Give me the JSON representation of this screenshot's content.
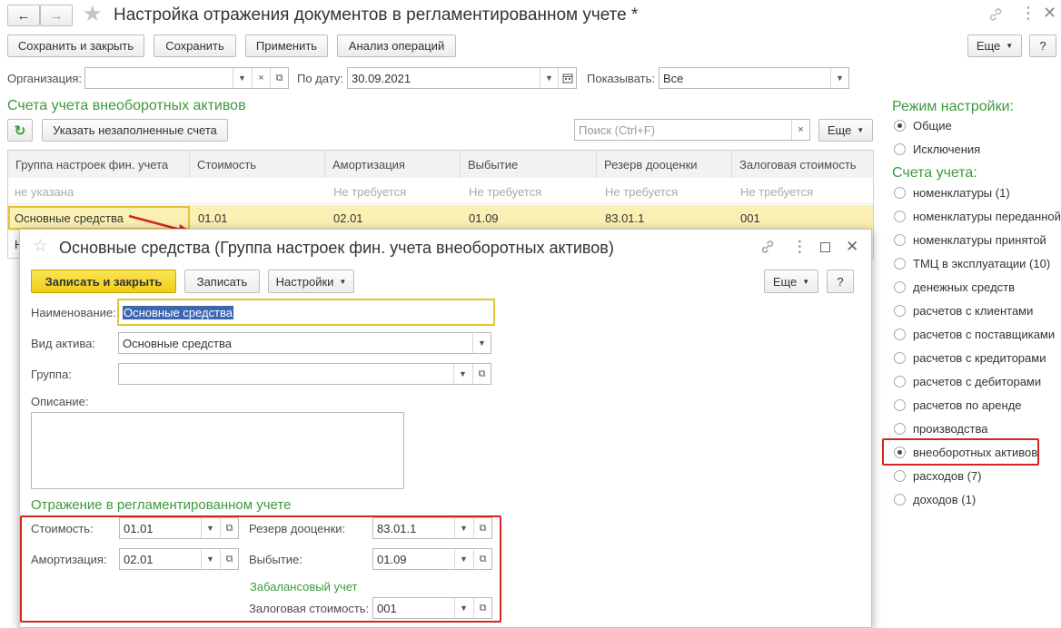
{
  "window": {
    "title": "Настройка отражения документов в регламентированном учете *",
    "nav_back": "←",
    "nav_forward": "→"
  },
  "toolbar": {
    "save_close": "Сохранить и закрыть",
    "save": "Сохранить",
    "apply": "Применить",
    "analysis": "Анализ операций",
    "more": "Еще",
    "help": "?"
  },
  "filters": {
    "org_label": "Организация:",
    "org_value": "",
    "date_label": "По дату:",
    "date_value": "30.09.2021",
    "show_label": "Показывать:",
    "show_value": "Все"
  },
  "accounts_section": {
    "title": "Счета учета внеоборотных активов",
    "fill_empty_button": "Указать незаполненные счета",
    "search_placeholder": "Поиск (Ctrl+F)",
    "more": "Еще",
    "columns": [
      "Группа настроек фин. учета",
      "Стоимость",
      "Амортизация",
      "Выбытие",
      "Резерв дооценки",
      "Залоговая стоимость"
    ],
    "rows": [
      [
        "не указана",
        "",
        "Не требуется",
        "Не требуется",
        "Не требуется",
        "Не требуется"
      ],
      [
        "Основные средства",
        "01.01",
        "02.01",
        "01.09",
        "83.01.1",
        "001"
      ]
    ],
    "partial_row": "Н"
  },
  "right_panel": {
    "mode_title": "Режим настройки:",
    "mode_options": [
      {
        "label": "Общие",
        "selected": true
      },
      {
        "label": "Исключения",
        "selected": false
      }
    ],
    "accounts_title": "Счета учета:",
    "accounts_options": [
      {
        "label": "номенклатуры (1)",
        "selected": false
      },
      {
        "label": "номенклатуры переданной",
        "selected": false
      },
      {
        "label": "номенклатуры принятой",
        "selected": false
      },
      {
        "label": "ТМЦ в эксплуатации (10)",
        "selected": false
      },
      {
        "label": "денежных средств",
        "selected": false
      },
      {
        "label": "расчетов с клиентами",
        "selected": false
      },
      {
        "label": "расчетов с поставщиками",
        "selected": false
      },
      {
        "label": "расчетов с кредиторами",
        "selected": false
      },
      {
        "label": "расчетов с дебиторами",
        "selected": false
      },
      {
        "label": "расчетов по аренде",
        "selected": false
      },
      {
        "label": "производства",
        "selected": false
      },
      {
        "label": "внеоборотных активов",
        "selected": true
      },
      {
        "label": "расходов (7)",
        "selected": false
      },
      {
        "label": "доходов (1)",
        "selected": false
      }
    ]
  },
  "dialog": {
    "title": "Основные средства (Группа настроек фин. учета внеоборотных активов)",
    "write_close": "Записать и закрыть",
    "write": "Записать",
    "settings": "Настройки",
    "more": "Еще",
    "help": "?",
    "name_label": "Наименование:",
    "name_value": "Основные средства",
    "asset_type_label": "Вид актива:",
    "asset_type_value": "Основные средства",
    "group_label": "Группа:",
    "group_value": "",
    "description_label": "Описание:",
    "description_value": "",
    "reflection_title": "Отражение в регламентированном учете",
    "cost_label": "Стоимость:",
    "cost_value": "01.01",
    "amort_label": "Амортизация:",
    "amort_value": "02.01",
    "reserve_label": "Резерв дооценки:",
    "reserve_value": "83.01.1",
    "disposal_label": "Выбытие:",
    "disposal_value": "01.09",
    "offbalance_title": "Забалансовый учет",
    "pledge_label": "Залоговая стоимость:",
    "pledge_value": "001"
  },
  "colors": {
    "accent_green": "#3c9a3c",
    "highlight_row": "#fbf0b4",
    "annotation_red": "#d32424",
    "primary_button": "#f4d424"
  }
}
